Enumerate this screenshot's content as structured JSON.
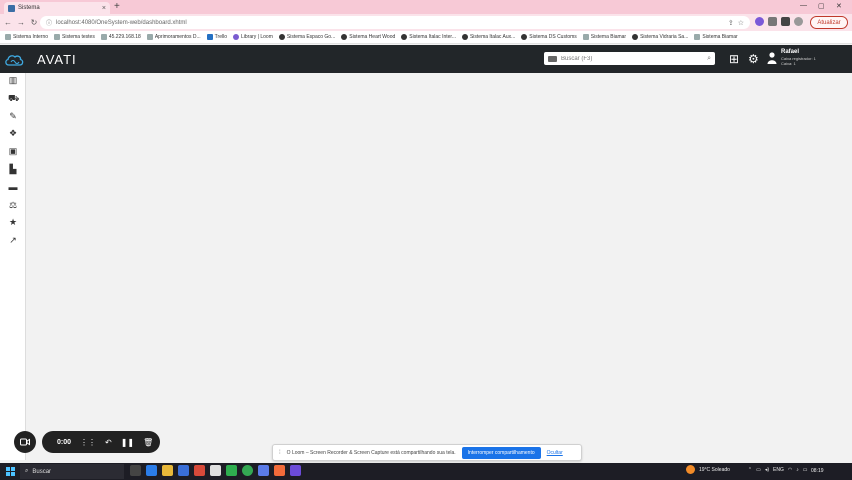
{
  "browser": {
    "tab_title": "Sistema",
    "url": "localhost:4080/OneSystem-web/dashboard.xhtml",
    "update_label": "Atualizar",
    "bookmarks": [
      {
        "label": "Sistema Interno",
        "icon": "page-icon"
      },
      {
        "label": "Sistema testes",
        "icon": "page-icon"
      },
      {
        "label": "45.229.168.18",
        "icon": "page-icon"
      },
      {
        "label": "Aprimoramentos D...",
        "icon": "page-icon"
      },
      {
        "label": "Trello",
        "icon": "trello-icon"
      },
      {
        "label": "Library | Loom",
        "icon": "loom-icon"
      },
      {
        "label": "Sistema Espaco Go...",
        "icon": "globe-icon"
      },
      {
        "label": "Sistema Heart Wood",
        "icon": "globe-icon"
      },
      {
        "label": "Sistema Italac Inter...",
        "icon": "globe-icon"
      },
      {
        "label": "Sistema Italac Aux...",
        "icon": "globe-icon"
      },
      {
        "label": "Sistema DS Customs",
        "icon": "globe-icon"
      },
      {
        "label": "Sistema Biamar",
        "icon": "page-icon"
      },
      {
        "label": "Sistema Vidraria Sa...",
        "icon": "globe-icon"
      },
      {
        "label": "Sistema Biamar",
        "icon": "page-icon"
      }
    ]
  },
  "app": {
    "brand": "AVATI",
    "search_placeholder": "Buscar (F3)",
    "user_name": "Rafael",
    "user_sub1": "Caixa registrador: 1",
    "user_sub2": "Caixa: 1"
  },
  "sidebar": {
    "items": [
      {
        "name": "book-icon",
        "glyph": "▥"
      },
      {
        "name": "cart-icon",
        "glyph": "⛟"
      },
      {
        "name": "wrench-icon",
        "glyph": "✎"
      },
      {
        "name": "cubes-icon",
        "glyph": "❖"
      },
      {
        "name": "money-icon",
        "glyph": "▣"
      },
      {
        "name": "industry-icon",
        "glyph": "▙"
      },
      {
        "name": "truck-icon",
        "glyph": "▬"
      },
      {
        "name": "scale-icon",
        "glyph": "⚖"
      },
      {
        "name": "star-icon",
        "glyph": "★"
      },
      {
        "name": "chart-icon",
        "glyph": "↗"
      }
    ]
  },
  "loom": {
    "time": "0:00"
  },
  "share_bar": {
    "message": "O Loom – Screen Recorder & Screen Capture está compartilhando sua tela.",
    "stop_label": "Interromper compartilhamento",
    "hide_label": "Ocultar"
  },
  "taskbar": {
    "search_label": "Buscar",
    "weather": "19°C  Soleado",
    "lang": "ENG",
    "time": "08:19"
  }
}
